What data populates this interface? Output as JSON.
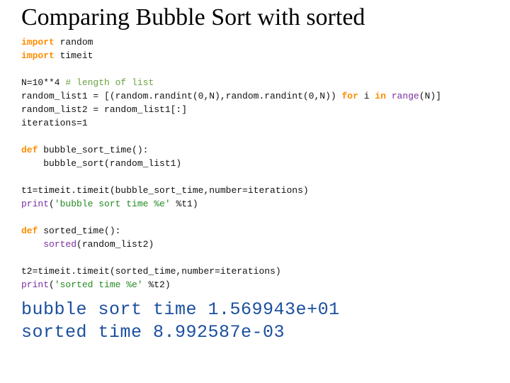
{
  "title": "Comparing Bubble Sort with sorted",
  "code": {
    "l1_kw": "import",
    "l1_mod": "random",
    "l2_kw": "import",
    "l2_mod": "timeit",
    "l3": "",
    "l4a": "N=10**4 ",
    "l4_comment": "# length of list",
    "l5a": "random_list1 = [(random.randint(0,N),random.randint(0,N)) ",
    "l5_for": "for",
    "l5_mid": " i ",
    "l5_in": "in",
    "l5_end": " ",
    "l5_range": "range",
    "l5_tail": "(N)]",
    "l6": "random_list2 = random_list1[:]",
    "l7": "iterations=1",
    "l8": "",
    "l9_def": "def",
    "l9_name": " bubble_sort_time",
    "l9_tail": "():",
    "l10": "    bubble_sort(random_list1)",
    "l11": "",
    "l12": "t1=timeit.timeit(bubble_sort_time,number=iterations)",
    "l13_print": "print",
    "l13_open": "(",
    "l13_str": "'bubble sort time %e'",
    "l13_tail": " %t1)",
    "l14": "",
    "l15_def": "def",
    "l15_name": " sorted_time",
    "l15_tail": "():",
    "l16a": "    ",
    "l16_sorted": "sorted",
    "l16_tail": "(random_list2)",
    "l17": "",
    "l18": "t2=timeit.timeit(sorted_time,number=iterations)",
    "l19_print": "print",
    "l19_open": "(",
    "l19_str": "'sorted time %e'",
    "l19_tail": " %t2)"
  },
  "output": {
    "line1": "bubble sort time 1.569943e+01",
    "line2": "sorted time 8.992587e-03"
  }
}
